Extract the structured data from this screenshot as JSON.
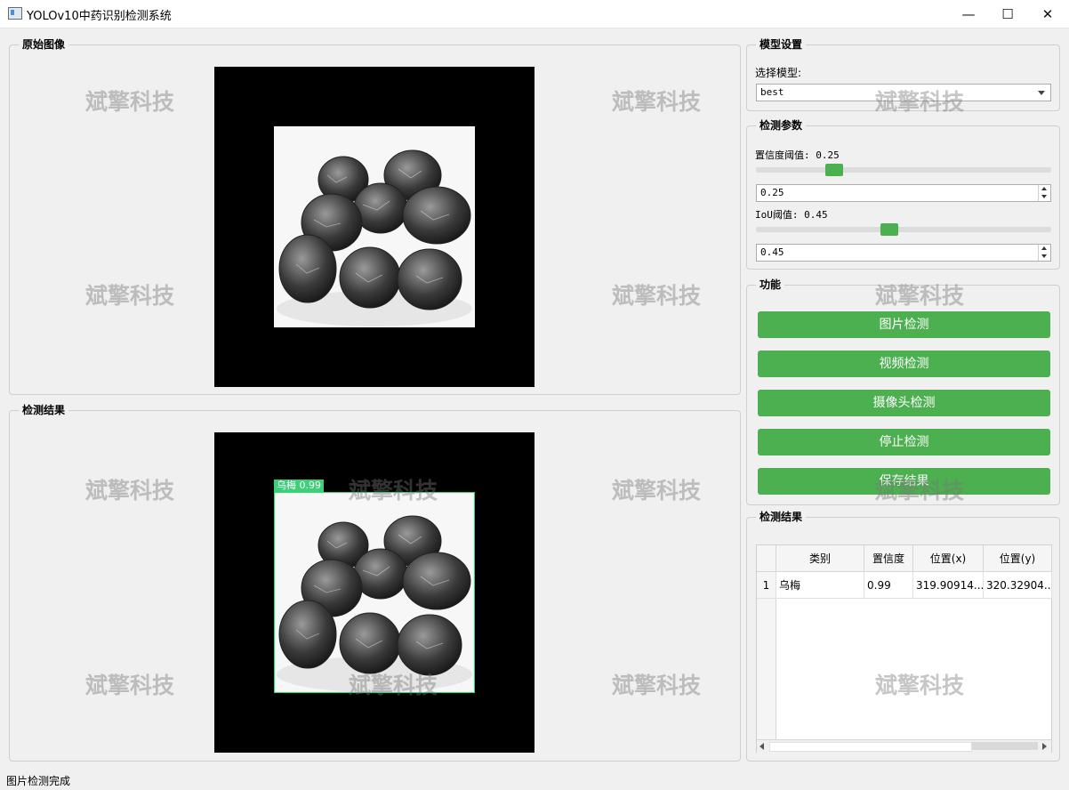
{
  "window": {
    "title": "YOLOv10中药识别检测系统",
    "icon": "app-window-icon",
    "controls": {
      "minimize": "—",
      "maximize": "☐",
      "close": "✕"
    }
  },
  "original_panel": {
    "title": "原始图像"
  },
  "result_panel": {
    "title": "检测结果"
  },
  "detection_label": "乌梅 0.99",
  "watermark": "斌擎科技",
  "model_settings": {
    "title": "模型设置",
    "select_label": "选择模型:",
    "selected_model": "best"
  },
  "detect_params": {
    "title": "检测参数",
    "conf_label": "置信度阈值: 0.25",
    "conf_value": "0.25",
    "conf_level": 0.25,
    "iou_label": "IoU阈值: 0.45",
    "iou_value": "0.45",
    "iou_level": 0.45
  },
  "functions": {
    "title": "功能",
    "buttons": [
      "图片检测",
      "视频检测",
      "摄像头检测",
      "停止检测",
      "保存结果"
    ]
  },
  "results_table": {
    "title": "检测结果",
    "headers": [
      "类别",
      "置信度",
      "位置(x)",
      "位置(y)"
    ],
    "rows": [
      {
        "index": "1",
        "class": "乌梅",
        "confidence": "0.99",
        "x": "319.90914...",
        "y": "320.32904..."
      }
    ]
  },
  "status": "图片检测完成",
  "colors": {
    "accent": "#4caf50",
    "detection_box": "#3ecf7a",
    "image_bg": "#000000"
  }
}
